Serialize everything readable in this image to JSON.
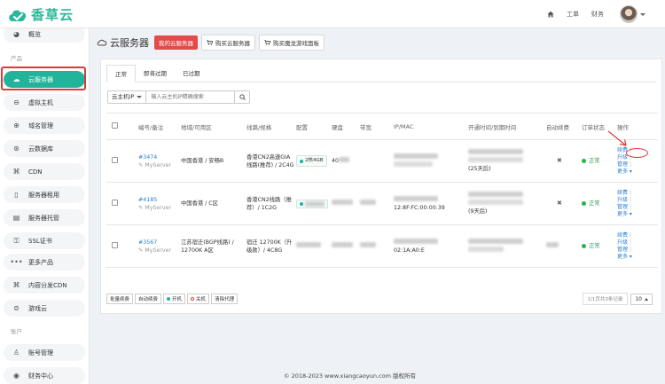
{
  "brand": {
    "name": "香草云"
  },
  "topbar": {
    "home_icon": "home-icon",
    "items": [
      {
        "label": "工单"
      },
      {
        "label": "财务"
      }
    ]
  },
  "sidebar": {
    "overview": {
      "label": "概览",
      "icon": "gauge-icon"
    },
    "section_products": "产品",
    "items": [
      {
        "label": "云服务器",
        "icon": "cloud-server-icon",
        "active": true
      },
      {
        "label": "虚拟主机",
        "icon": "virtual-host-icon"
      },
      {
        "label": "域名管理",
        "icon": "globe-icon"
      },
      {
        "label": "云数据库",
        "icon": "database-icon"
      },
      {
        "label": "CDN",
        "icon": "cdn-icon"
      },
      {
        "label": "服务器租用",
        "icon": "server-icon"
      },
      {
        "label": "服务器托管",
        "icon": "rack-icon"
      },
      {
        "label": "SSL证书",
        "icon": "ssl-icon"
      },
      {
        "label": "更多产品",
        "icon": "more-icon"
      },
      {
        "label": "内容分发CDN",
        "icon": "distribution-icon"
      },
      {
        "label": "游戏云",
        "icon": "gamepad-icon"
      }
    ],
    "section_account": "账户",
    "account_items": [
      {
        "label": "账号管理",
        "icon": "user-icon"
      },
      {
        "label": "财务中心",
        "icon": "finance-icon"
      }
    ]
  },
  "page": {
    "title": "云服务器",
    "btn_mine": "我的云服务器",
    "btn_buy": "购买云服务器",
    "btn_buy_game": "购买魔龙游戏面板"
  },
  "tabs": [
    {
      "label": "正常"
    },
    {
      "label": "即将过期"
    },
    {
      "label": "已过期"
    }
  ],
  "search": {
    "type": "云主机IP",
    "placeholder": "输入云主机IP精确搜索"
  },
  "table": {
    "headers": [
      "编号/备注",
      "地域/可用区",
      "线路/规格",
      "配置",
      "硬盘",
      "带宽",
      "IP/MAC",
      "开通时间/到期时间",
      "自动续费",
      "订单状态",
      "操作"
    ],
    "rows": [
      {
        "id": "#3474",
        "remark": "MyServer",
        "region": "中国香港 / 安畅B",
        "line": "香港CN2高速GIA线路(推荐) / 2C4G",
        "config": "2核4GB",
        "disk": "40",
        "bandwidth": "",
        "ip": "",
        "time_extra": "(25天后)",
        "auto_renew": "✖",
        "status": "正常",
        "ops": [
          "续费",
          "升级",
          "管理",
          "更多"
        ]
      },
      {
        "id": "#4185",
        "remark": "MyServer",
        "region": "中国香港 / C区",
        "line": "香港CN2线路（推荐）/ 1C2G",
        "config": "",
        "disk": "",
        "bandwidth": "",
        "ip": "12:8F:FC:00:00:39",
        "time_extra": "(9天后)",
        "auto_renew": "✖",
        "status": "正常",
        "ops": [
          "续费",
          "升级",
          "管理",
          "更多"
        ]
      },
      {
        "id": "#3567",
        "remark": "MyServer",
        "region": "江苏宿迁(BGP线路) / 12700K A区",
        "line": "宿迁 12700K（升级款）/ 4C8G",
        "config": "",
        "disk": "",
        "bandwidth": "",
        "ip": "02:1A:A0:E",
        "time_extra": "",
        "auto_renew": "",
        "status": "正常",
        "ops": [
          "续费",
          "升级",
          "管理",
          "更多"
        ]
      }
    ]
  },
  "bulk": {
    "renew": "批量续费",
    "auto": "自动续费",
    "on": "开机",
    "off": "关机",
    "clear": "清除代理"
  },
  "pager": {
    "info": "1/1页共3条记录",
    "size": "10"
  },
  "footer": "© 2018-2023 www.xiangcaoyun.com 版权所有"
}
